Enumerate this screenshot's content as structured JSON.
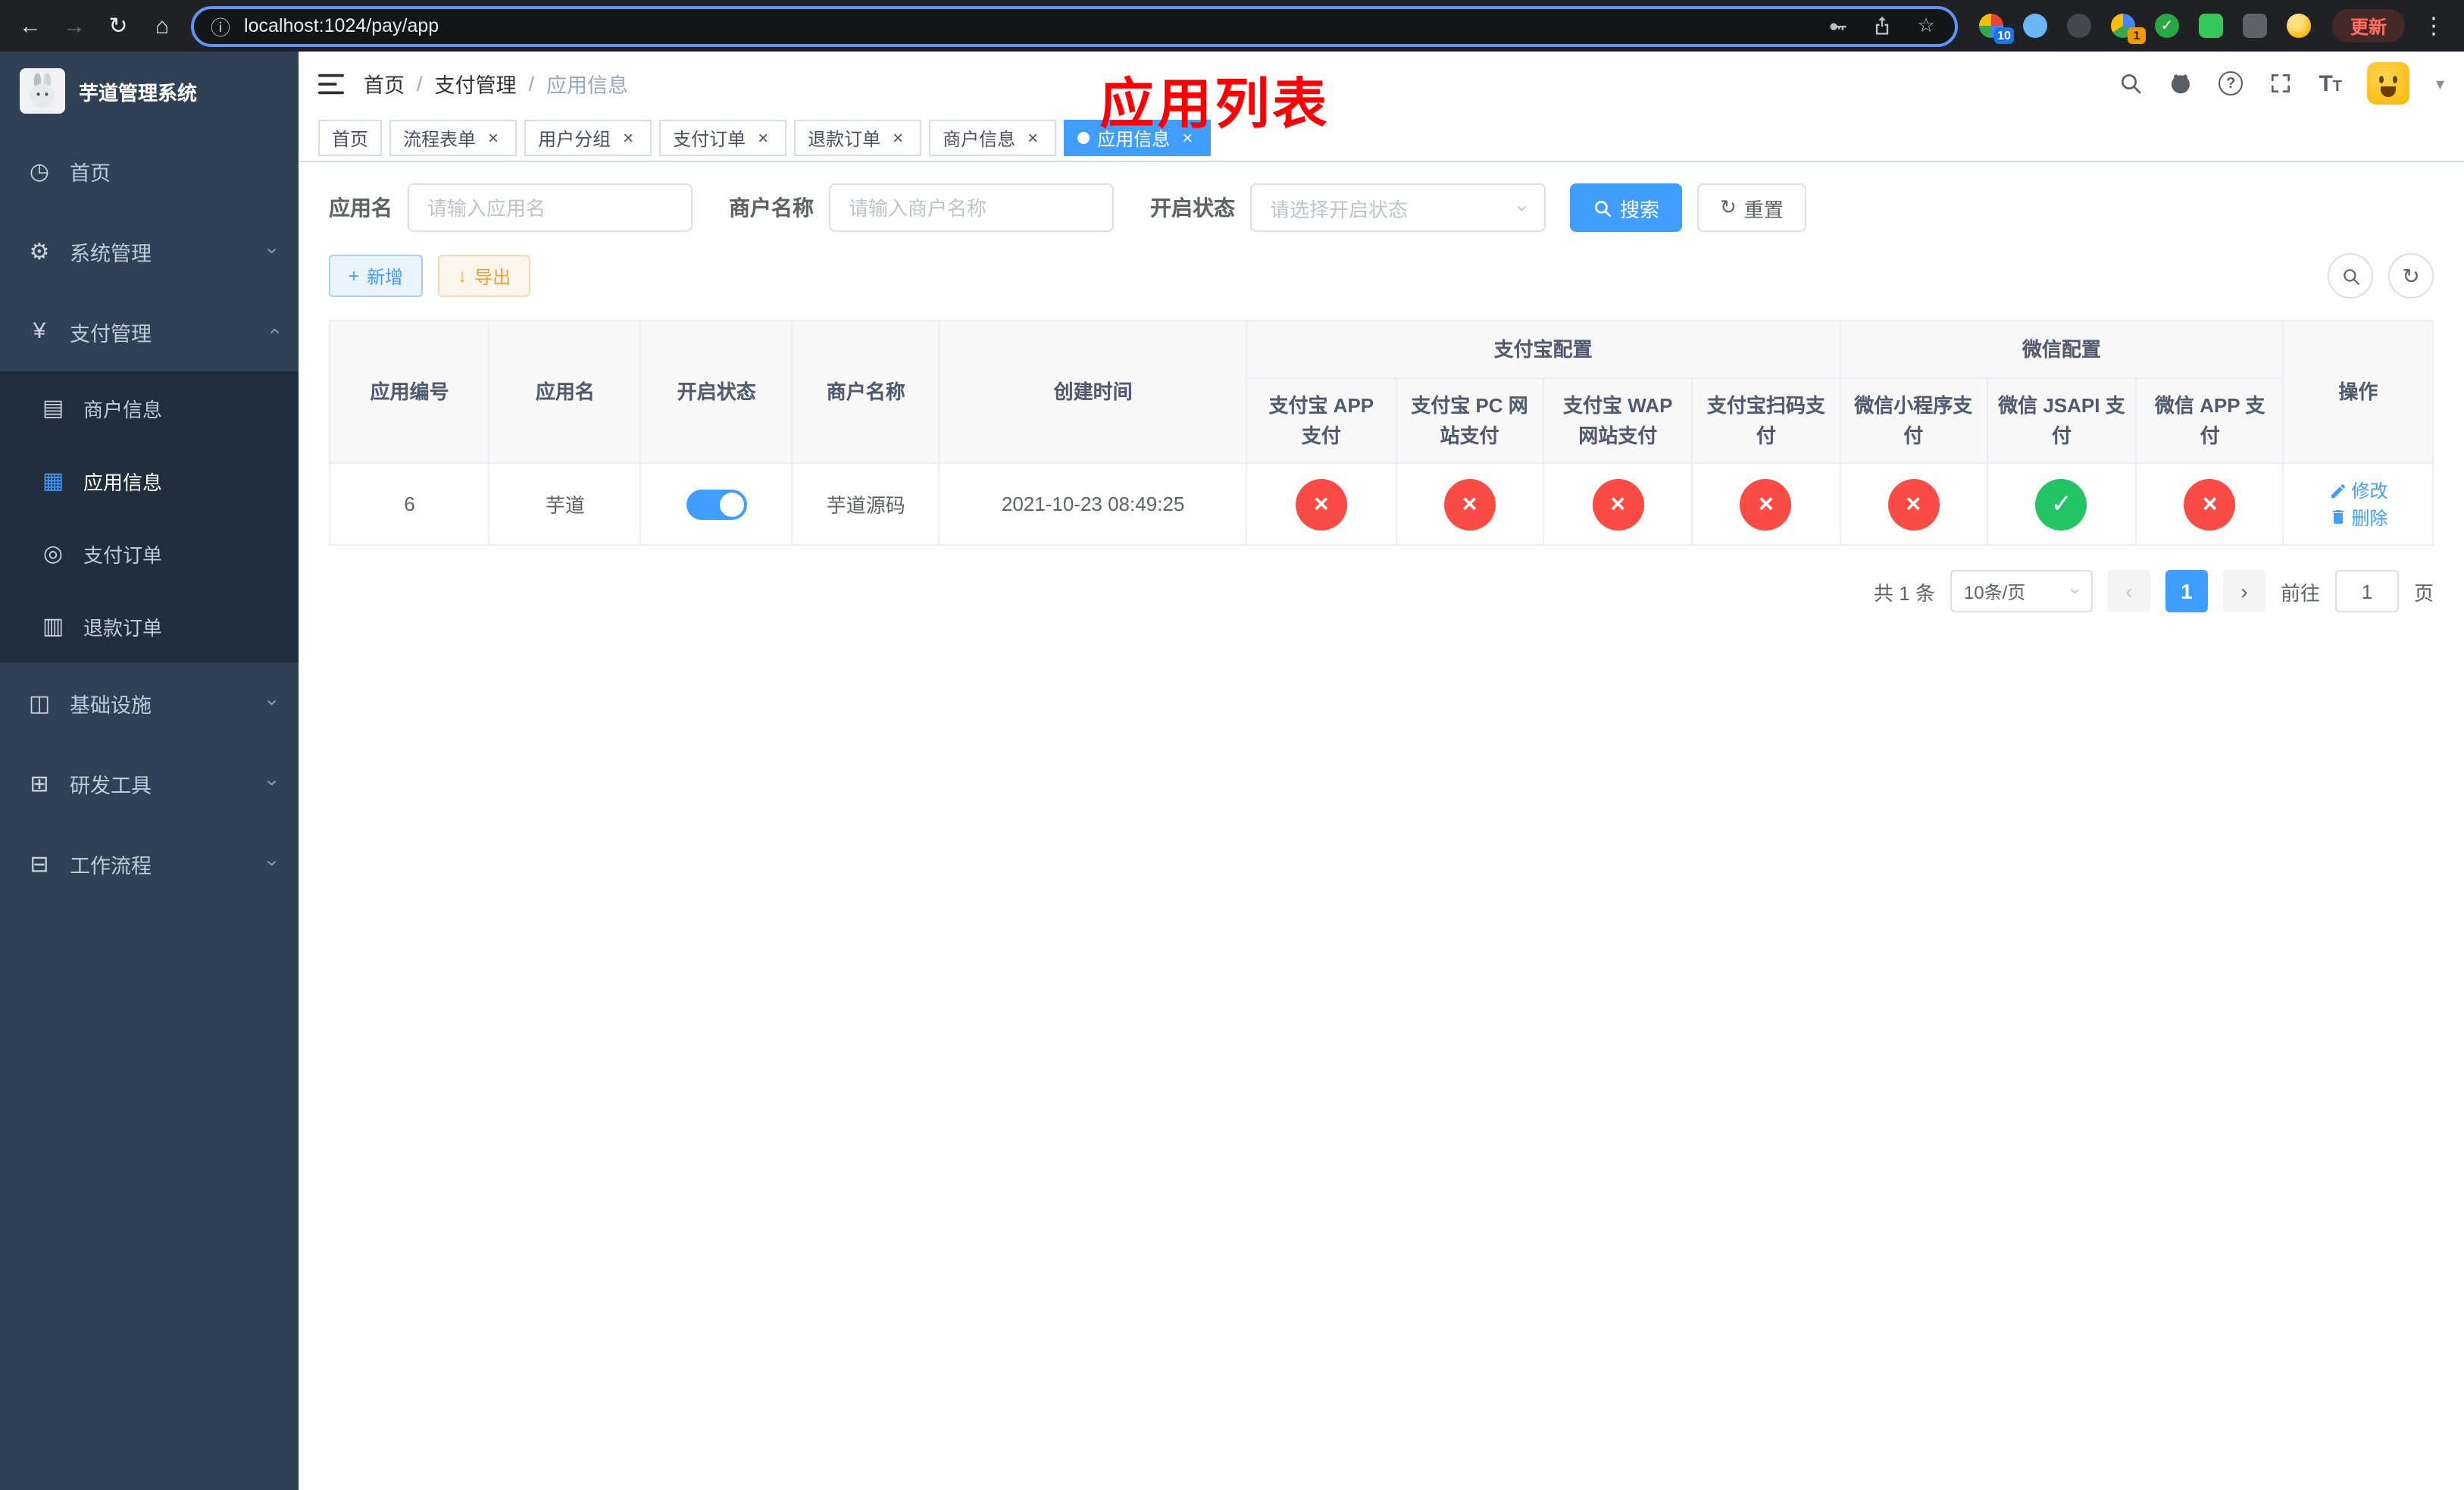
{
  "colors": {
    "primary": "#409eff",
    "status_off": "#fa4b44",
    "status_on": "#22c463",
    "annotation": "#ff0000"
  },
  "icons": {
    "back": "←",
    "forward": "→",
    "reload": "↻",
    "home": "⌂",
    "info": "ⓘ",
    "star": "☆",
    "more": "⋮",
    "close": "×",
    "caret_down": "▾",
    "caret_select": "›",
    "refresh": "↻",
    "plus": "+",
    "download": "↓",
    "question": "?",
    "check_small": "✓",
    "breadcrumb_sep": "/",
    "chevron": "›",
    "text_size": "T",
    "menu_home": "◷",
    "menu_system": "⚙",
    "menu_payment": "¥",
    "menu_merchant": "▤",
    "menu_app": "▦",
    "menu_order": "◎",
    "menu_refund": "▥",
    "menu_infra": "◫",
    "menu_tools": "⊞",
    "menu_flow": "⊟"
  },
  "browser": {
    "url": "localhost:1024/pay/app",
    "update_label": "更新",
    "extensions": {
      "grid_badge": "10",
      "colorful_badge": "1"
    }
  },
  "sidebar": {
    "title": "芋道管理系统",
    "items": [
      {
        "label": "首页"
      },
      {
        "label": "系统管理"
      },
      {
        "label": "支付管理"
      },
      {
        "label": "商户信息"
      },
      {
        "label": "应用信息"
      },
      {
        "label": "支付订单"
      },
      {
        "label": "退款订单"
      },
      {
        "label": "基础设施"
      },
      {
        "label": "研发工具"
      },
      {
        "label": "工作流程"
      }
    ]
  },
  "navbar": {
    "breadcrumb": [
      "首页",
      "支付管理",
      "应用信息"
    ]
  },
  "annotation": {
    "title": "应用列表"
  },
  "tabs": [
    {
      "label": "首页",
      "closable": false,
      "active": false
    },
    {
      "label": "流程表单",
      "closable": true,
      "active": false
    },
    {
      "label": "用户分组",
      "closable": true,
      "active": false
    },
    {
      "label": "支付订单",
      "closable": true,
      "active": false
    },
    {
      "label": "退款订单",
      "closable": true,
      "active": false
    },
    {
      "label": "商户信息",
      "closable": true,
      "active": false
    },
    {
      "label": "应用信息",
      "closable": true,
      "active": true
    }
  ],
  "filters": {
    "app_name_label": "应用名",
    "app_name_placeholder": "请输入应用名",
    "merchant_label": "商户名称",
    "merchant_placeholder": "请输入商户名称",
    "status_label": "开启状态",
    "status_placeholder": "请选择开启状态",
    "search_label": "搜索",
    "reset_label": "重置"
  },
  "toolbar": {
    "add_label": "新增",
    "export_label": "导出"
  },
  "table": {
    "headers": {
      "app_id": "应用编号",
      "app_name": "应用名",
      "status": "开启状态",
      "merchant": "商户名称",
      "created": "创建时间",
      "alipay_group": "支付宝配置",
      "wechat_group": "微信配置",
      "actions": "操作",
      "alipay_cols": [
        "支付宝 APP 支付",
        "支付宝 PC 网站支付",
        "支付宝 WAP 网站支付",
        "支付宝扫码支付"
      ],
      "wechat_cols": [
        "微信小程序支付",
        "微信 JSAPI 支付",
        "微信 APP 支付"
      ]
    },
    "row": {
      "app_id": "6",
      "app_name": "芋道",
      "status_on": true,
      "merchant": "芋道源码",
      "created": "2021-10-23 08:49:25",
      "pay_statuses": [
        "×",
        "×",
        "×",
        "×",
        "×",
        "✓",
        "×"
      ],
      "pay_statuses_enabled": [
        false,
        false,
        false,
        false,
        false,
        true,
        false
      ],
      "edit_label": "修改",
      "delete_label": "删除"
    }
  },
  "pagination": {
    "total_text": "共 1 条",
    "page_size": "10条/页",
    "prev": "‹",
    "current_page": "1",
    "next": "›",
    "go_prefix": "前往",
    "go_value": "1",
    "go_suffix": "页"
  }
}
